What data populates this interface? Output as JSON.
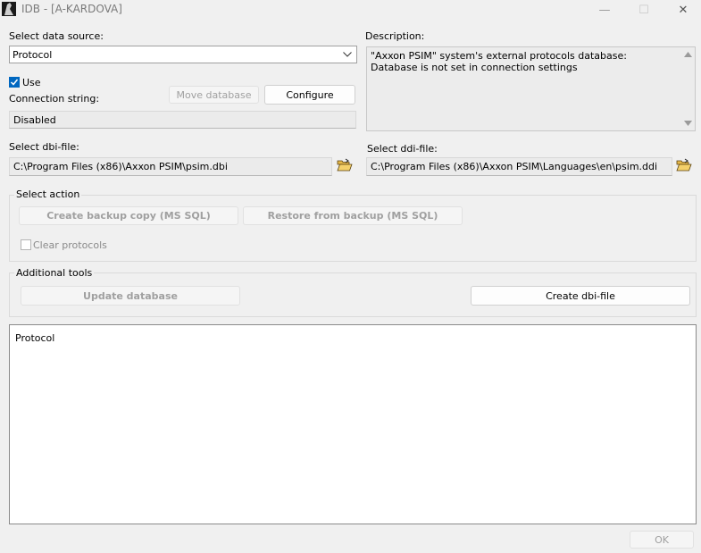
{
  "window": {
    "title": "IDB - [A-KARDOVA]",
    "controls": {
      "minimize": "—",
      "maximize": "☐",
      "close": "✕"
    }
  },
  "data_source": {
    "label": "Select data source:",
    "value": "Protocol"
  },
  "use": {
    "label": "Use",
    "checked": true
  },
  "connection": {
    "label": "Connection string:",
    "value": "Disabled",
    "move_button": "Move database",
    "configure_button": "Configure"
  },
  "description": {
    "label": "Description:",
    "line1": "\"Axxon PSIM\" system's external protocols database:",
    "line2": "Database is not set in connection settings"
  },
  "dbi": {
    "label": "Select dbi-file:",
    "value": "C:\\Program Files (x86)\\Axxon PSIM\\psim.dbi"
  },
  "ddi": {
    "label": "Select ddi-file:",
    "value": "C:\\Program Files (x86)\\Axxon PSIM\\Languages\\en\\psim.ddi"
  },
  "select_action": {
    "title": "Select action",
    "backup_button": "Create backup copy (MS SQL)",
    "restore_button": "Restore from backup (MS SQL)",
    "clear_label": "Clear protocols"
  },
  "additional_tools": {
    "title": "Additional tools",
    "update_button": "Update database",
    "create_dbi_button": "Create dbi-file"
  },
  "log": {
    "text": "Protocol"
  },
  "ok_button": "OK",
  "colors": {
    "accent": "#0067c0",
    "disabled_text": "#a0a0a0"
  }
}
